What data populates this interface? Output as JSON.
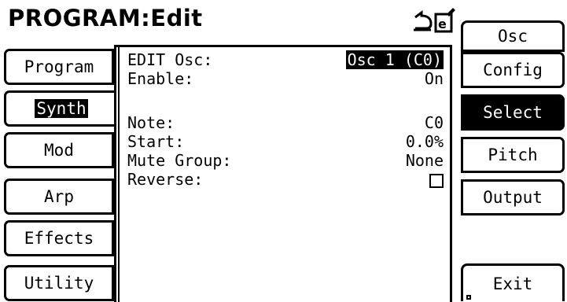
{
  "header": {
    "title": "PROGRAM:Edit",
    "icons": [
      "undo-icon",
      "edit-document-icon"
    ]
  },
  "left_tabs": [
    {
      "label": "Program",
      "active": false
    },
    {
      "label": "Synth",
      "active": true
    },
    {
      "label": "Mod",
      "active": false
    },
    {
      "label": "Arp",
      "active": false
    },
    {
      "label": "Effects",
      "active": false
    },
    {
      "label": "Utility",
      "active": false
    }
  ],
  "right_tabs": [
    {
      "label": "Osc",
      "selected": false
    },
    {
      "label": "Config",
      "selected": false
    },
    {
      "label": "Select",
      "selected": true
    },
    {
      "label": "Pitch",
      "selected": false
    },
    {
      "label": "Output",
      "selected": false
    },
    {
      "label": "Exit",
      "selected": false
    }
  ],
  "params": {
    "edit_osc": {
      "label": "EDIT Osc:",
      "value": "Osc 1 (C0)"
    },
    "enable": {
      "label": "Enable:",
      "value": "On"
    },
    "note": {
      "label": "Note:",
      "value": "C0"
    },
    "start": {
      "label": "Start:",
      "value": "0.0%"
    },
    "mute_group": {
      "label": "Mute Group:",
      "value": "None"
    },
    "reverse": {
      "label": "Reverse:",
      "checked": false
    }
  }
}
